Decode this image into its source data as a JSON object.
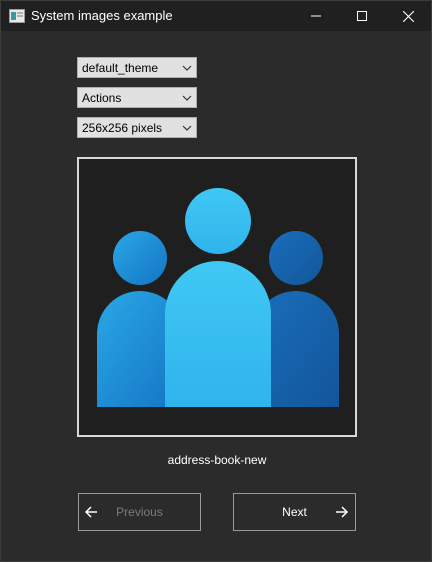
{
  "window": {
    "title": "System images example",
    "app_icon": "app-window-icon",
    "controls": [
      "minimize-icon",
      "maximize-icon",
      "close-icon"
    ]
  },
  "selectors": {
    "theme": {
      "value": "default_theme"
    },
    "category": {
      "value": "Actions"
    },
    "size": {
      "value": "256x256 pixels"
    }
  },
  "preview": {
    "icon": "contacts-people-icon",
    "caption": "address-book-new"
  },
  "navigation": {
    "previous_label": "Previous",
    "previous_enabled": false,
    "next_label": "Next",
    "next_enabled": true
  },
  "colors": {
    "background": "#2b2b2b",
    "titlebar": "#202020",
    "icon_light": "#3cc2f0",
    "icon_mid": "#1e88d6",
    "icon_dark": "#1565a8",
    "disabled_text": "#7a7a7a"
  }
}
